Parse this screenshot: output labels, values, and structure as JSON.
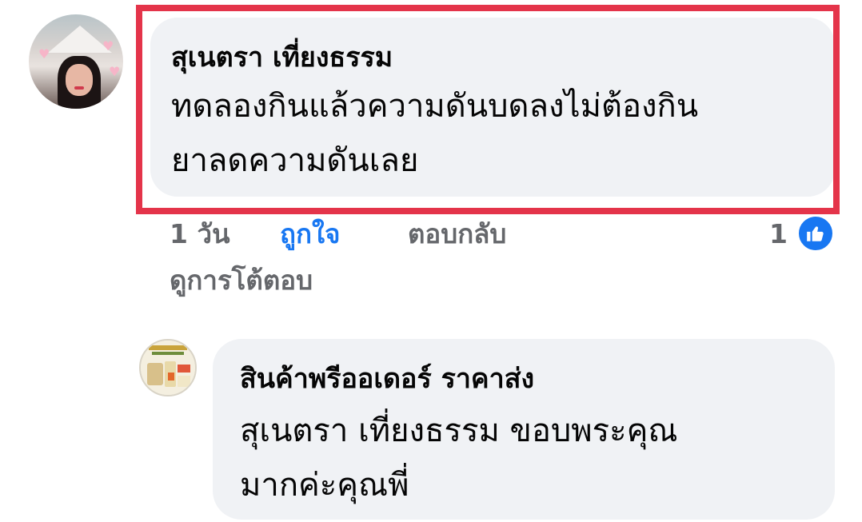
{
  "comment": {
    "author": "สุเนตรา เที่ยงธรรม",
    "text_line1": "ทดลองกินแล้วความดันบดลงไม่ต้องกิน",
    "text_line2": "ยาลดความดันเลย",
    "time": "1 วัน",
    "like_label": "ถูกใจ",
    "reply_label": "ตอบกลับ",
    "reaction_count": "1",
    "view_replies": "ดูการโต้ตอบ",
    "highlight_color": "#e4344a"
  },
  "reply": {
    "author": "สินค้าพรีออเดอร์ ราคาส่ง",
    "text_line1": "สุเนตรา เที่ยงธรรม ขอบพระคุณ",
    "text_line2": "มากค่ะคุณพี่"
  },
  "colors": {
    "bubble": "#f0f2f5",
    "like_blue": "#1877f2",
    "meta_gray": "#65676b",
    "text": "#050505"
  },
  "icons": {
    "reaction": "thumbs-up-icon"
  }
}
